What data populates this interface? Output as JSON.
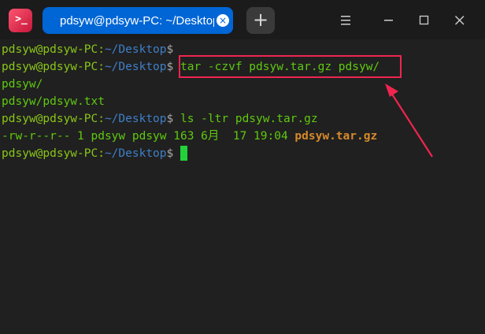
{
  "app": {
    "icon_text": ">_"
  },
  "tabs": [
    {
      "label": "pdsyw@pdsyw-PC: ~/Desktop",
      "active": true
    }
  ],
  "titlebar": {
    "new_tab_label": "+"
  },
  "terminal": {
    "prompt": {
      "user": "pdsyw@pdsyw-PC",
      "sep": ":",
      "path": "~/Desktop",
      "dollar": "$"
    },
    "lines": [
      {
        "cmd": ""
      },
      {
        "cmd": " tar -czvf pdsyw.tar.gz pdsyw/"
      },
      {
        "output": "pdsyw/"
      },
      {
        "output": "pdsyw/pdsyw.txt"
      },
      {
        "cmd": " ls -ltr pdsyw.tar.gz"
      },
      {
        "output": "-rw-r--r-- 1 pdsyw pdsyw 163 6月  17 19:04 ",
        "file": "pdsyw.tar.gz"
      },
      {
        "cmd": " "
      }
    ]
  },
  "colors": {
    "tab_active": "#0066d6",
    "prompt_user": "#8ac618",
    "prompt_path": "#3f7fc7",
    "command": "#5fc90f",
    "archive_file": "#d6892a",
    "annotation": "#f0254f",
    "cursor": "#23d23a"
  },
  "icons": {
    "menu": "hamburger-menu-icon",
    "minimize": "minimize-icon",
    "maximize": "maximize-icon",
    "close": "close-icon"
  }
}
